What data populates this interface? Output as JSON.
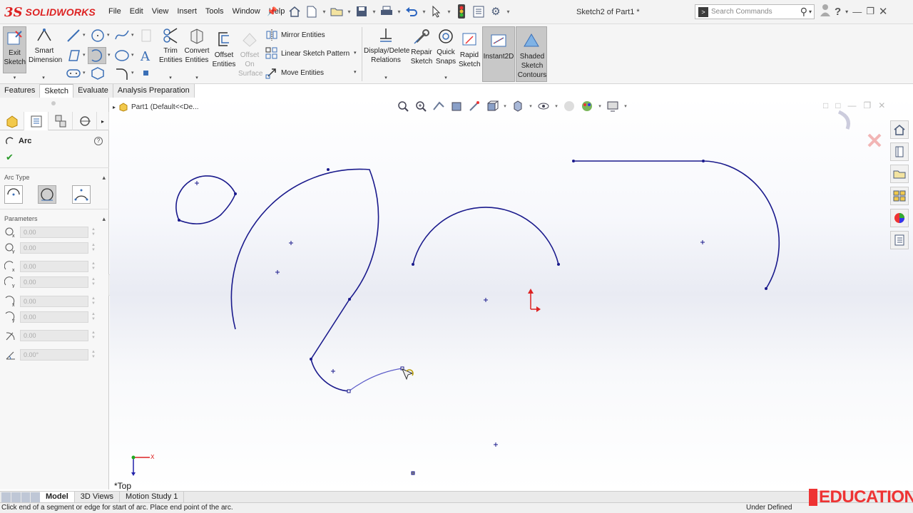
{
  "app": {
    "brand": "SOLIDWORKS",
    "brand_prefix": "3S",
    "document_title": "Sketch2 of Part1 *"
  },
  "menu": [
    "File",
    "Edit",
    "View",
    "Insert",
    "Tools",
    "Window",
    "Help"
  ],
  "search": {
    "placeholder": "Search Commands"
  },
  "command_manager": {
    "exit_sketch": "Exit Sketch",
    "smart_dimension": "Smart Dimension",
    "trim_entities": "Trim Entities",
    "convert_entities": "Convert Entities",
    "offset_entities": "Offset Entities",
    "offset_on_surface": "Offset On Surface",
    "mirror_entities": "Mirror Entities",
    "linear_sketch_pattern": "Linear Sketch Pattern",
    "move_entities": "Move Entities",
    "display_delete_relations": "Display/Delete Relations",
    "repair_sketch": "Repair Sketch",
    "quick_snaps": "Quick Snaps",
    "rapid_sketch": "Rapid Sketch",
    "instant2d": "Instant2D",
    "shaded_sketch_contours": "Shaded Sketch Contours"
  },
  "cm_tabs": [
    "Features",
    "Sketch",
    "Evaluate",
    "Analysis Preparation"
  ],
  "cm_tabs_active": "Sketch",
  "property_manager": {
    "title": "Arc",
    "arc_type_header": "Arc Type",
    "parameters_header": "Parameters",
    "parameters": [
      "0.00",
      "0.00",
      "0.00",
      "0.00",
      "0.00",
      "0.00",
      "0.00",
      "0.00°"
    ]
  },
  "feature_tree": {
    "label": "Part1  (Default<<De..."
  },
  "view": {
    "orientation": "*Top"
  },
  "bottom_tabs": [
    "Model",
    "3D Views",
    "Motion Study 1"
  ],
  "bottom_tabs_active": "Model",
  "status": {
    "message": "Click end of a segment or edge for start of arc.  Place end point of the arc.",
    "sketch_state": "Under Defined"
  },
  "watermark": "EDUCATION",
  "colors": {
    "sketch_line": "#1a1a8c",
    "accent_red": "#d22222",
    "watermark": "#e33333"
  }
}
